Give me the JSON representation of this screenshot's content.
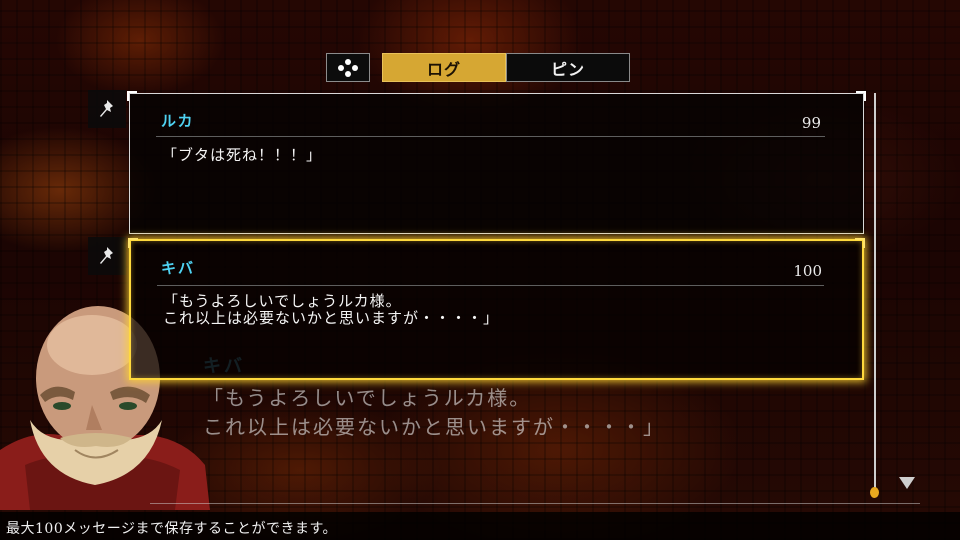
{
  "tabs": [
    {
      "label": "ログ",
      "active": true
    },
    {
      "label": "ピン",
      "active": false
    }
  ],
  "tab_icon": "dpad-icon",
  "entries": [
    {
      "speaker": "ルカ",
      "number": "99",
      "text": "「ブタは死ね！！！」",
      "pin_icon": "pin-icon",
      "selected": false
    },
    {
      "speaker": "キバ",
      "number": "100",
      "text": "「もうよろしいでしょうルカ様。\nこれ以上は必要ないかと思いますが・・・・」",
      "pin_icon": "pin-icon",
      "selected": true
    }
  ],
  "background_dialogue": {
    "speaker": "キバ",
    "text": "「もうよろしいでしょうルカ様。\nこれ以上は必要ないかと思いますが・・・・」"
  },
  "footer": {
    "help_text": "最大100メッセージまで保存することができます。"
  },
  "colors": {
    "accent": "#d6a733",
    "selection": "#ffd93d",
    "speaker": "#4fd2f2"
  }
}
